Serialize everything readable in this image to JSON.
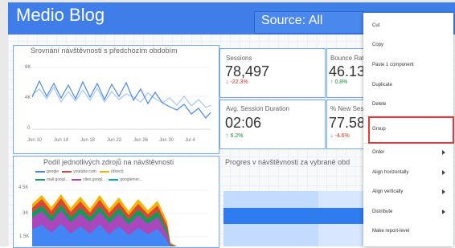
{
  "report": {
    "title": "Medio Blog",
    "source_label": "Source: All"
  },
  "cards": {
    "trend_title": "Srovnání návštěvnosti s předchozím obdobím",
    "y_ticks": [
      "8K",
      "4K",
      "0"
    ],
    "x_ticks": [
      "Jun 10",
      "Jun 14",
      "Jun 18",
      "Jun 22",
      "Jun 26",
      "Jun 30",
      "Jul 4"
    ],
    "sources_title": "Podíl jednotlivých zdrojů na návštěvnosti",
    "sources_y_ticks": [
      "4.5K",
      "3K",
      "1.5K"
    ],
    "legend_row1": [
      "google",
      "youtube.com",
      "(direct)"
    ],
    "legend_row2": [
      "mail.googl...",
      "sites.googl...",
      "googlemer..."
    ],
    "progress_title": "Progres v návštěvnosti za vybrané obd"
  },
  "metrics": [
    {
      "label": "Sessions",
      "value": "78,497",
      "delta": "↓ -22.3%"
    },
    {
      "label": "Bounce Rat",
      "value": "46.13",
      "delta": "↑ 0.8%"
    },
    {
      "label": "Avg. Session Duration",
      "value": "02:06",
      "delta": "↑ 6.2%"
    },
    {
      "label": "% New Ses",
      "value": "77.58",
      "delta": "↓ -4.6%"
    }
  ],
  "context_menu": {
    "items": [
      {
        "label": "Cut"
      },
      {
        "label": "Copy"
      },
      {
        "label": "Paste 1 component"
      },
      {
        "label": "Duplicate"
      },
      {
        "label": "Delete"
      },
      {
        "label": "Group",
        "highlighted": true
      },
      {
        "label": "Order",
        "submenu": true
      },
      {
        "label": "Align horizontally",
        "submenu": true
      },
      {
        "label": "Align vertically",
        "submenu": true
      },
      {
        "label": "Distribute",
        "submenu": true
      },
      {
        "label": "Make report-level"
      }
    ]
  },
  "colors": {
    "header": "#3f7ee8",
    "accent": "#4a88ee",
    "highlight": "#e53935",
    "legend": [
      "#4285f4",
      "#db4437",
      "#f4b400",
      "#0f9d58",
      "#ab47bc",
      "#00acc1"
    ]
  }
}
